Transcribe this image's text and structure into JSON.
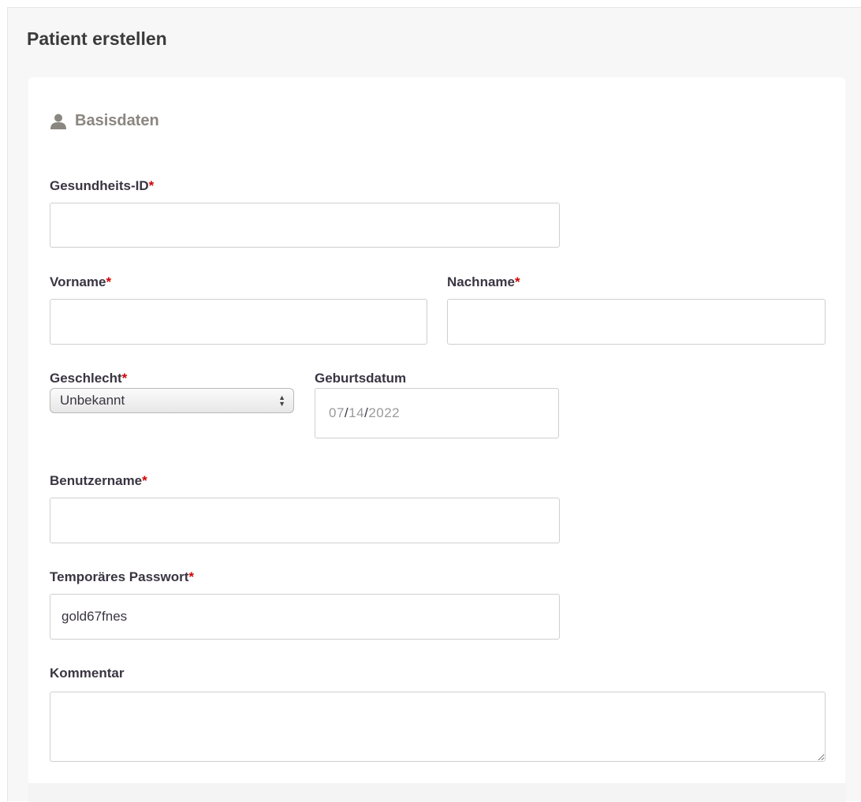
{
  "page": {
    "title": "Patient erstellen"
  },
  "section": {
    "title": "Basisdaten",
    "icon": "user-icon"
  },
  "form": {
    "required_marker": "*",
    "health_id": {
      "label": "Gesundheits-ID",
      "value": ""
    },
    "first_name": {
      "label": "Vorname",
      "value": ""
    },
    "last_name": {
      "label": "Nachname",
      "value": ""
    },
    "gender": {
      "label": "Geschlecht",
      "value": "Unbekannt"
    },
    "birth_date": {
      "label": "Geburtsdatum",
      "month": "07",
      "day": "14",
      "year": "2022",
      "separator": "/"
    },
    "username": {
      "label": "Benutzername",
      "value": ""
    },
    "temp_password": {
      "label": "Temporäres Passwort",
      "value": "gold67fnes"
    },
    "comment": {
      "label": "Kommentar",
      "value": ""
    }
  },
  "colors": {
    "required": "#d40000",
    "section_title": "#8a8680",
    "label": "#3a3542"
  }
}
